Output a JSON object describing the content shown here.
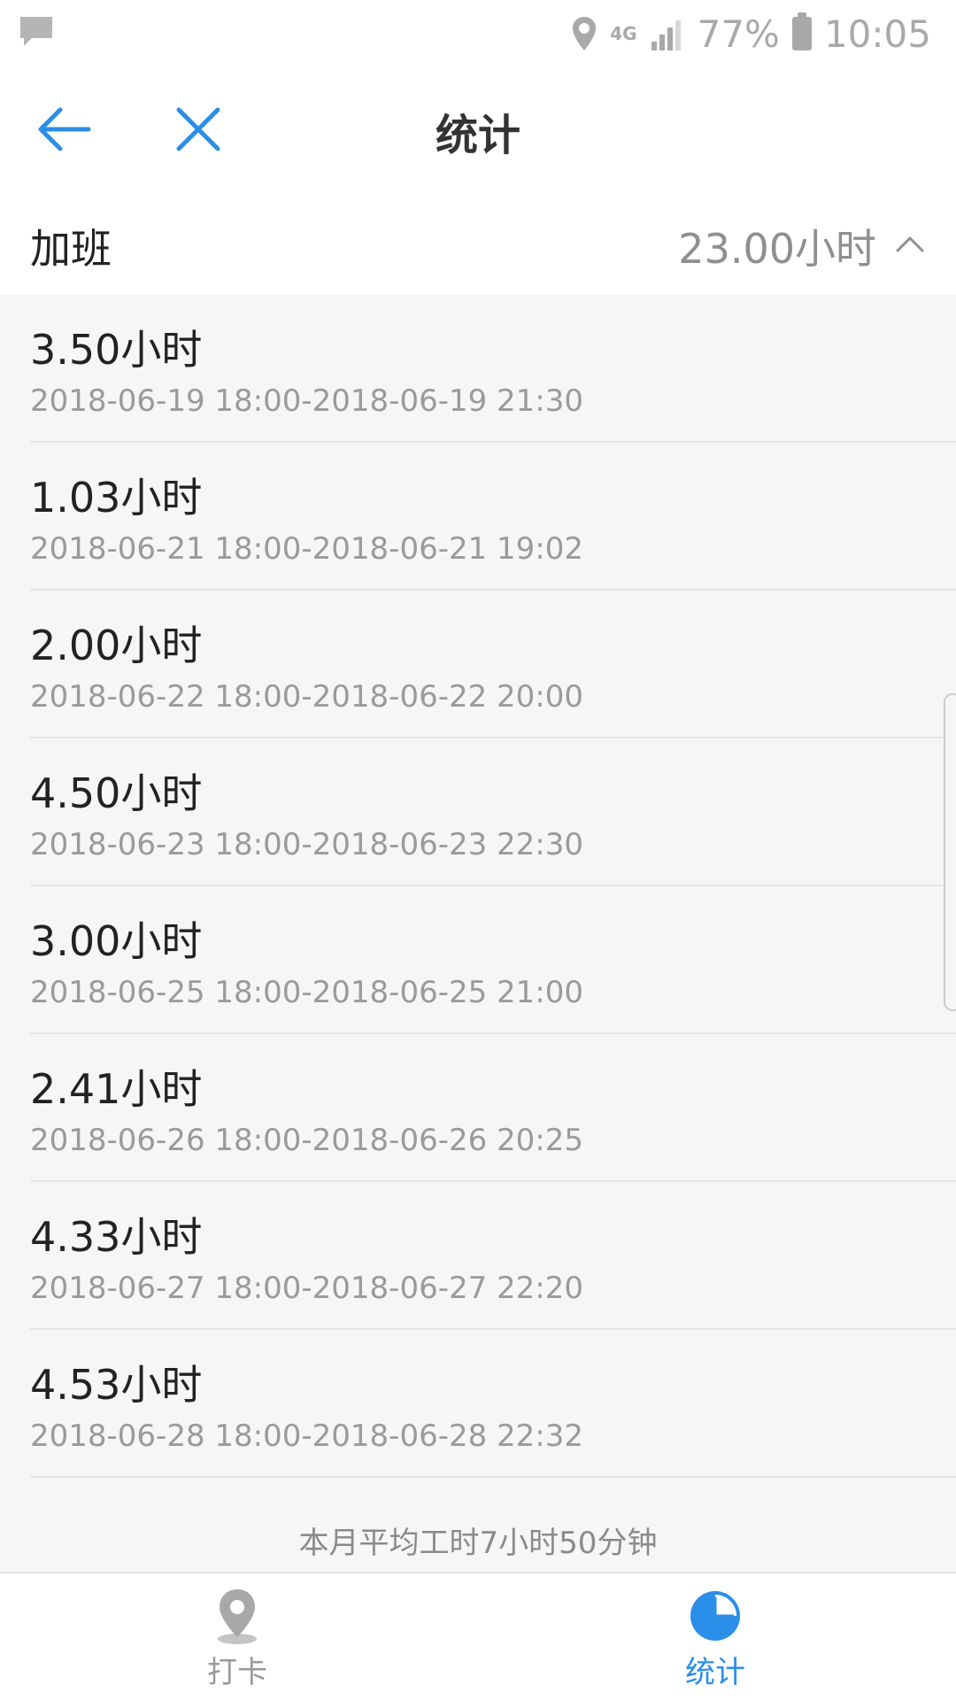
{
  "status_bar": {
    "network": "4G",
    "battery": "77%",
    "time": "10:05"
  },
  "nav": {
    "title": "统计"
  },
  "section": {
    "title": "加班",
    "total": "23.00小时"
  },
  "records": [
    {
      "hours": "3.50小时",
      "range": "2018-06-19 18:00-2018-06-19 21:30"
    },
    {
      "hours": "1.03小时",
      "range": "2018-06-21 18:00-2018-06-21 19:02"
    },
    {
      "hours": "2.00小时",
      "range": "2018-06-22 18:00-2018-06-22 20:00"
    },
    {
      "hours": "4.50小时",
      "range": "2018-06-23 18:00-2018-06-23 22:30"
    },
    {
      "hours": "3.00小时",
      "range": "2018-06-25 18:00-2018-06-25 21:00"
    },
    {
      "hours": "2.41小时",
      "range": "2018-06-26 18:00-2018-06-26 20:25"
    },
    {
      "hours": "4.33小时",
      "range": "2018-06-27 18:00-2018-06-27 22:20"
    },
    {
      "hours": "4.53小时",
      "range": "2018-06-28 18:00-2018-06-28 22:32"
    }
  ],
  "summary": "本月平均工时7小时50分钟",
  "tabs": [
    {
      "label": "打卡",
      "icon": "location-pin-icon",
      "active": false
    },
    {
      "label": "统计",
      "icon": "pie-chart-icon",
      "active": true
    }
  ],
  "colors": {
    "accent": "#2b8ee8",
    "muted_text": "#9a9a9a",
    "list_background": "#f6f6f6"
  }
}
